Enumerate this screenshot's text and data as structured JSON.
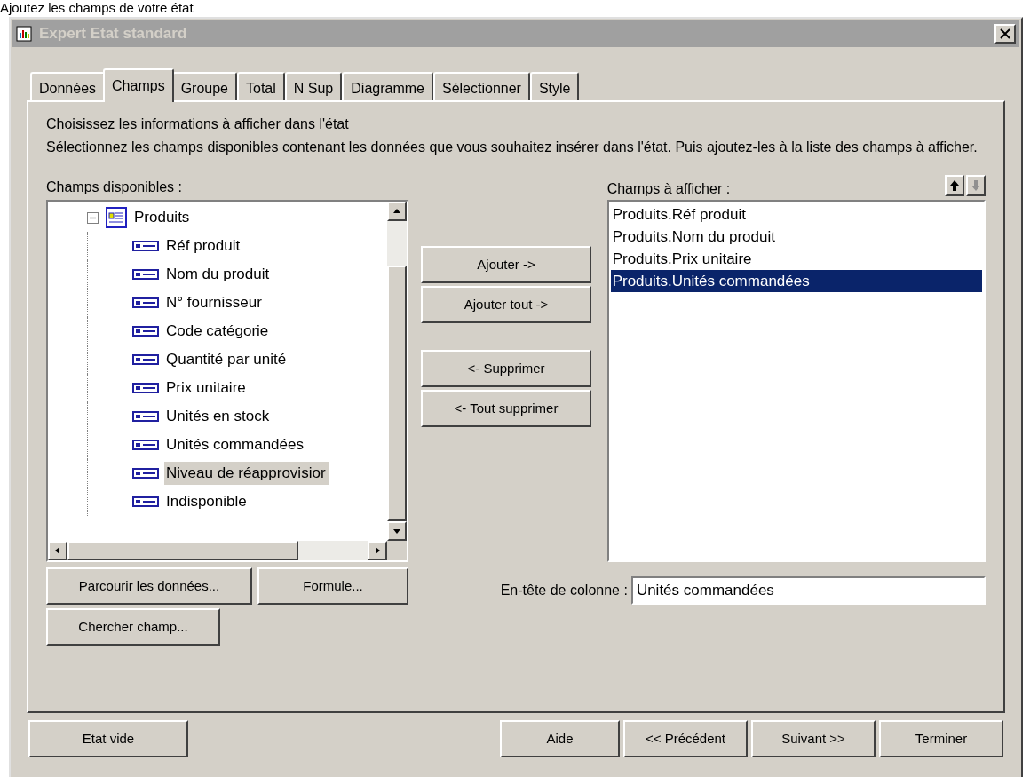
{
  "caption": "Ajoutez les champs de votre état",
  "window": {
    "title": "Expert Etat standard"
  },
  "tabs": [
    {
      "label": "Données",
      "selected": false
    },
    {
      "label": "Champs",
      "selected": true
    },
    {
      "label": "Groupe",
      "selected": false
    },
    {
      "label": "Total",
      "selected": false
    },
    {
      "label": "N Sup",
      "selected": false
    },
    {
      "label": "Diagramme",
      "selected": false
    },
    {
      "label": "Sélectionner",
      "selected": false
    },
    {
      "label": "Style",
      "selected": false
    }
  ],
  "heading": "Choisissez les informations à afficher dans l'état",
  "description": "Sélectionnez les champs disponibles contenant les données que vous souhaitez insérer dans l'état. Puis ajoutez-les à la liste des champs à afficher.",
  "available_fields": {
    "label": "Champs disponibles :",
    "tree": [
      {
        "label": "Produits",
        "expanded": true,
        "selected": false,
        "children": [
          {
            "label": "Réf produit",
            "selected": false
          },
          {
            "label": "Nom du produit",
            "selected": false
          },
          {
            "label": "N° fournisseur",
            "selected": false
          },
          {
            "label": "Code catégorie",
            "selected": false
          },
          {
            "label": "Quantité par unité",
            "selected": false
          },
          {
            "label": "Prix unitaire",
            "selected": false
          },
          {
            "label": "Unités en stock",
            "selected": false
          },
          {
            "label": "Unités commandées",
            "selected": false
          },
          {
            "label": "Niveau de réapprovisior",
            "selected": true
          },
          {
            "label": "Indisponible",
            "selected": false
          }
        ]
      }
    ]
  },
  "left_buttons": [
    "Parcourir les données...",
    "Formule...",
    "Chercher champ..."
  ],
  "move_buttons": [
    {
      "label": "Ajouter ->"
    },
    {
      "label": "Ajouter tout ->"
    },
    {
      "label": "<- Supprimer"
    },
    {
      "label": "<- Tout supprimer"
    }
  ],
  "fields_to_display": {
    "label": "Champs à afficher :",
    "move_up_disabled": false,
    "move_down_disabled": true,
    "items": [
      {
        "label": "Produits.Réf produit",
        "selected": false
      },
      {
        "label": "Produits.Nom du produit",
        "selected": false
      },
      {
        "label": "Produits.Prix unitaire",
        "selected": false
      },
      {
        "label": "Produits.Unités commandées",
        "selected": true
      }
    ]
  },
  "column_header": {
    "label": "En-tête de colonne :",
    "value": "Unités commandées"
  },
  "footer_buttons": {
    "left": [
      "Etat vide"
    ],
    "right": [
      "Aide",
      "<< Précédent",
      "Suivant >>",
      "Terminer"
    ]
  }
}
